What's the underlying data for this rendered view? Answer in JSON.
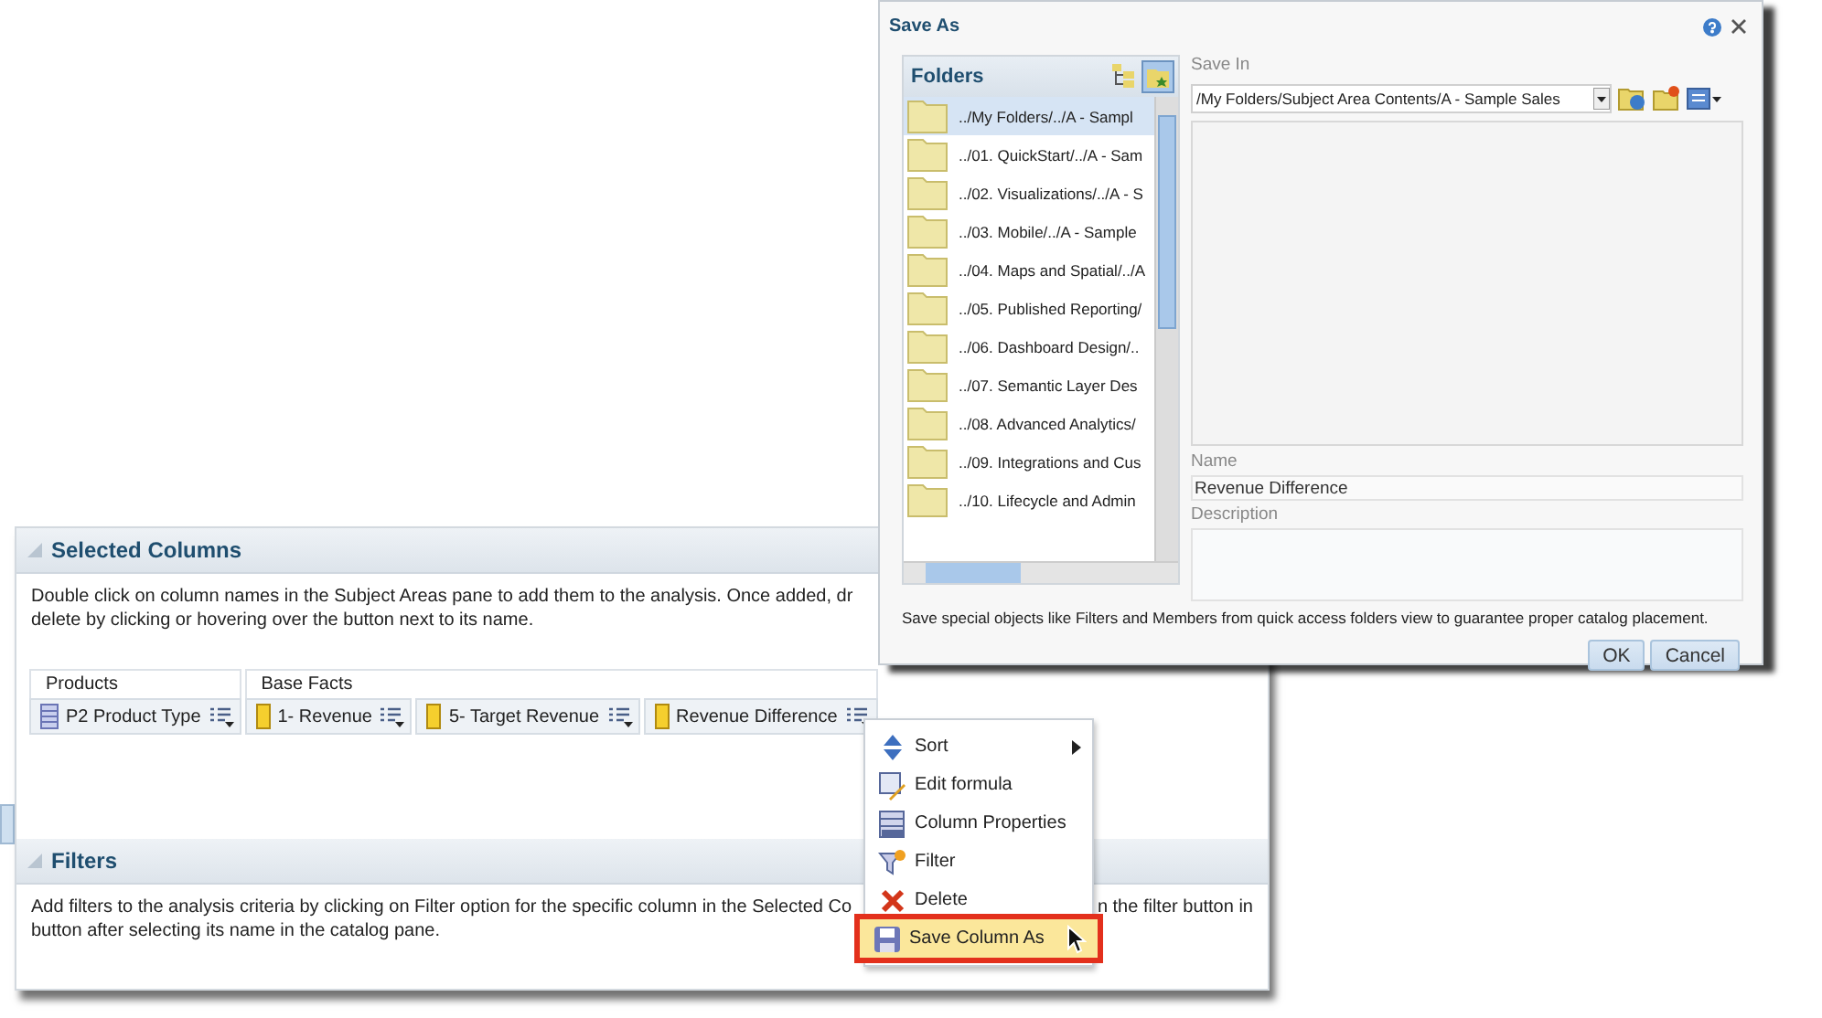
{
  "analysis": {
    "selected_columns": {
      "title": "Selected Columns",
      "expanded": true,
      "help_lines": [
        "Double click on column names in the Subject Areas pane to add them to the analysis. Once added, dr",
        "delete by clicking or hovering over the button next to its name."
      ],
      "groups": [
        {
          "name": "Products",
          "columns": [
            {
              "kind": "attribute",
              "name": "P2 Product Type"
            }
          ]
        },
        {
          "name": "Base Facts",
          "columns": [
            {
              "kind": "measure",
              "name": "1- Revenue"
            },
            {
              "kind": "measure",
              "name": "5- Target Revenue"
            },
            {
              "kind": "measure",
              "name": "Revenue Difference"
            }
          ]
        }
      ]
    },
    "filters": {
      "title": "Filters",
      "expanded": true,
      "help_line_1_left": "Add filters to the analysis criteria by clicking on Filter option for the specific column in the Selected Co",
      "help_line_1_right": "n the filter button in",
      "help_line_2": "button after selecting its name in the catalog pane."
    }
  },
  "context_menu": {
    "items": [
      {
        "kind": "sort",
        "label": "Sort",
        "submenu": true,
        "selected": false
      },
      {
        "kind": "formula",
        "label": "Edit formula",
        "submenu": false,
        "selected": false
      },
      {
        "kind": "properties",
        "label": "Column Properties",
        "submenu": false,
        "selected": false
      },
      {
        "kind": "filter",
        "label": "Filter",
        "submenu": false,
        "selected": false
      },
      {
        "kind": "delete",
        "label": "Delete",
        "submenu": false,
        "selected": false
      },
      {
        "kind": "save",
        "label": "Save Column As",
        "submenu": false,
        "selected": true
      }
    ]
  },
  "save_as_dialog": {
    "title": "Save As",
    "folders": {
      "title": "Folders",
      "items": [
        {
          "label": "../My Folders/../A - Sampl",
          "selected": true
        },
        {
          "label": "../01. QuickStart/../A - Sam",
          "selected": false
        },
        {
          "label": "../02. Visualizations/../A - S",
          "selected": false
        },
        {
          "label": "../03. Mobile/../A - Sample",
          "selected": false
        },
        {
          "label": "../04. Maps and Spatial/../A",
          "selected": false
        },
        {
          "label": "../05. Published Reporting/",
          "selected": false
        },
        {
          "label": "../06. Dashboard Design/..",
          "selected": false
        },
        {
          "label": "../07. Semantic Layer Des",
          "selected": false
        },
        {
          "label": "../08. Advanced Analytics/",
          "selected": false
        },
        {
          "label": "../09. Integrations and Cus",
          "selected": false
        },
        {
          "label": "../10. Lifecycle and Admin",
          "selected": false
        }
      ]
    },
    "save_in": {
      "label": "Save In",
      "value": "/My Folders/Subject Area Contents/A - Sample Sales"
    },
    "name": {
      "label": "Name",
      "value": "Revenue Difference"
    },
    "description": {
      "label": "Description"
    },
    "note": "Save special objects like Filters and Members from quick access folders view to guarantee proper catalog placement.",
    "buttons": [
      "OK",
      "Cancel"
    ]
  }
}
